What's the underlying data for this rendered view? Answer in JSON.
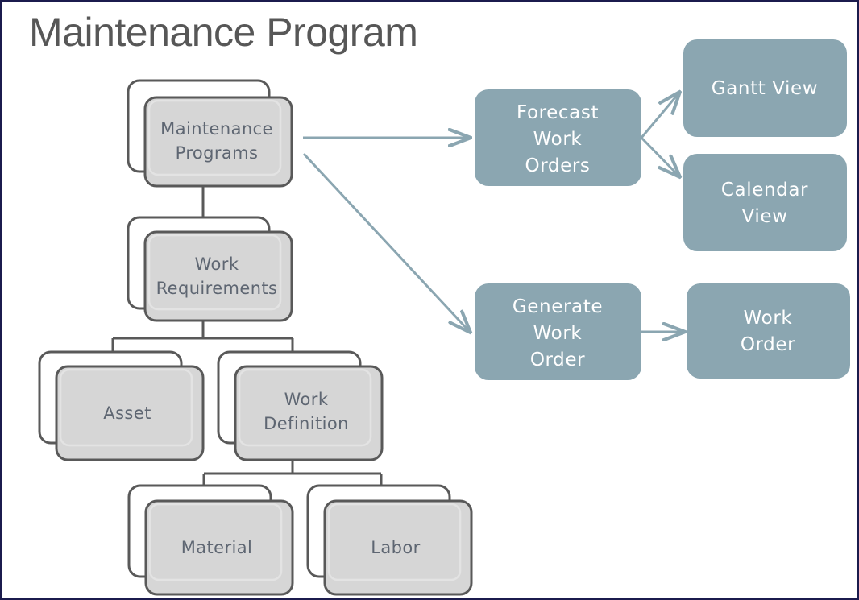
{
  "page": {
    "title": "Maintenance Program",
    "border_color": "#1b1b4d",
    "background_color": "#ffffff"
  },
  "colors": {
    "title_text": "#575757",
    "stack_front_fill": "#d6d6d6",
    "stack_back_fill": "#ffffff",
    "stack_stroke": "#595959",
    "stack_inner_stroke": "#e3e3e3",
    "stack_text": "#5e6672",
    "blue_box_fill": "#8ba6b1",
    "blue_box_text": "#ffffff",
    "connector_line": "#595959",
    "flow_arrow": "#8ba6b1"
  },
  "entity_stacks": [
    {
      "id": "maintenance-programs",
      "lines": [
        "Maintenance",
        "Programs"
      ]
    },
    {
      "id": "work-requirements",
      "lines": [
        "Work",
        "Requirements"
      ]
    },
    {
      "id": "asset",
      "lines": [
        "Asset"
      ]
    },
    {
      "id": "work-definition",
      "lines": [
        "Work",
        "Definition"
      ]
    },
    {
      "id": "material",
      "lines": [
        "Material"
      ]
    },
    {
      "id": "labor",
      "lines": [
        "Labor"
      ]
    }
  ],
  "process_boxes": [
    {
      "id": "forecast-work-orders",
      "lines": [
        "Forecast",
        "Work",
        "Orders"
      ]
    },
    {
      "id": "gantt-view",
      "lines": [
        "Gantt View"
      ]
    },
    {
      "id": "calendar-view",
      "lines": [
        "Calendar",
        "View"
      ]
    },
    {
      "id": "generate-work-order",
      "lines": [
        "Generate",
        "Work",
        "Order"
      ]
    },
    {
      "id": "work-order",
      "lines": [
        "Work",
        "Order"
      ]
    }
  ]
}
